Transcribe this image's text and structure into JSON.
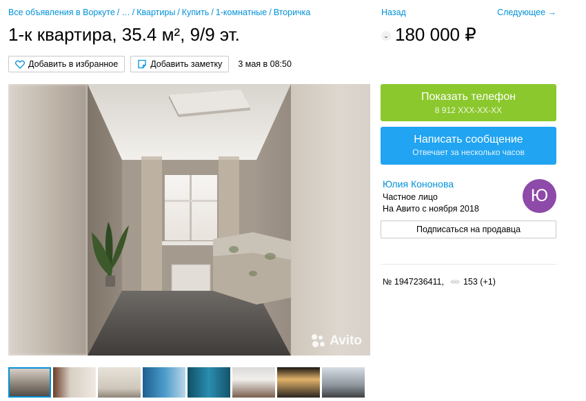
{
  "breadcrumb": [
    "Все объявления в Воркуте",
    "…",
    "Квартиры",
    "Купить",
    "1-комнатные",
    "Вторичка"
  ],
  "breadcrumb_sep": "/",
  "nav": {
    "back": "Назад",
    "next": "Следующее →"
  },
  "listing": {
    "title": "1-к квартира, 35.4 м², 9/9 эт.",
    "price": "180 000 ₽",
    "date": "3 мая в 08:50"
  },
  "actions": {
    "favorite": "Добавить в избранное",
    "note": "Добавить заметку"
  },
  "gallery": {
    "watermark": "Avito",
    "thumbnail_count": 8
  },
  "contact": {
    "phone_label": "Показать телефон",
    "phone_masked": "8 912 XXX-XX-XX",
    "message_label": "Написать сообщение",
    "message_sub": "Отвечает за несколько часов"
  },
  "seller": {
    "name": "Юлия Кононова",
    "type": "Частное лицо",
    "since": "На Авито с ноября 2018",
    "avatar_letter": "Ю",
    "subscribe": "Подписаться на продавца"
  },
  "meta": {
    "id": "№ 1947236411,",
    "views": "153 (+1)"
  },
  "colors": {
    "link": "#0091d9",
    "phone_button": "#8bc82d",
    "message_button": "#21a4f1",
    "avatar": "#8e4aa8"
  }
}
